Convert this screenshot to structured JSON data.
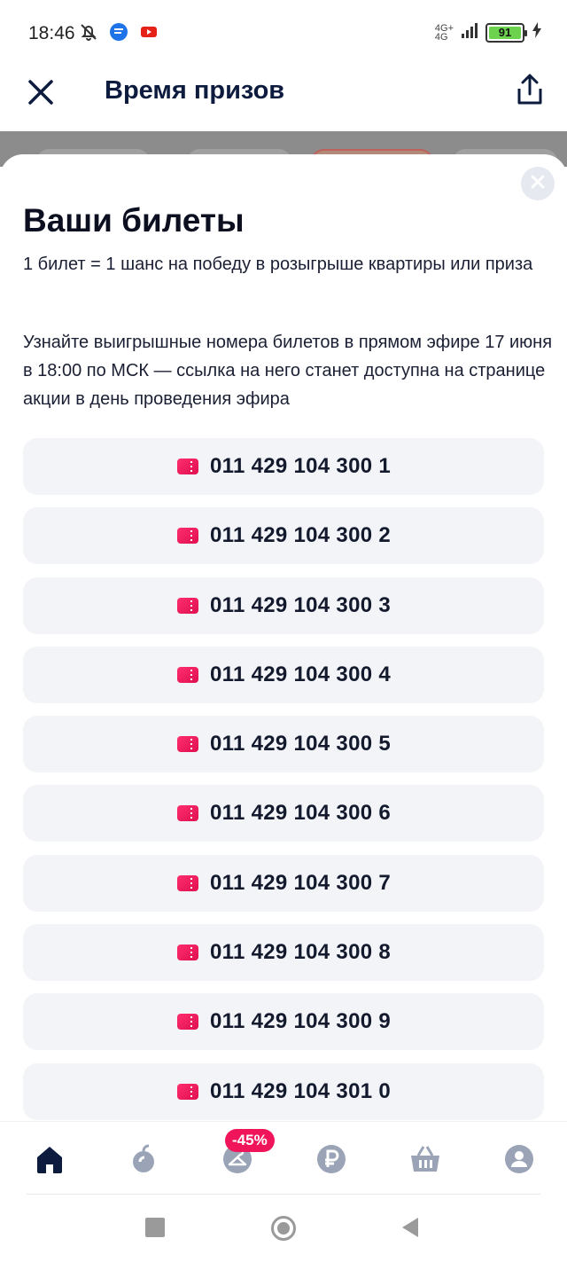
{
  "status_bar": {
    "time": "18:46",
    "network": "4G+",
    "network_sub": "4G",
    "battery": "91"
  },
  "header": {
    "title": "Время призов"
  },
  "sheet": {
    "title": "Ваши билеты",
    "paragraph1": "1 билет = 1 шанс на победу в розыгрыше квартиры или приза",
    "paragraph2": "Узнайте выигрышные номера билетов в прямом эфире 17 июня в 18:00 по МСК — ссылка на него станет доступна на странице акции в день проведения эфира",
    "tickets": [
      "011 429 104 300 1",
      "011 429 104 300 2",
      "011 429 104 300 3",
      "011 429 104 300 4",
      "011 429 104 300 5",
      "011 429 104 300 6",
      "011 429 104 300 7",
      "011 429 104 300 8",
      "011 429 104 300 9",
      "011 429 104 301 0"
    ]
  },
  "bottom_nav": {
    "discount_badge": "-45%",
    "items": [
      "home-icon",
      "catalog-icon",
      "clothes-icon",
      "ruble-icon",
      "cart-icon",
      "profile-icon"
    ]
  },
  "colors": {
    "accent": "#f0155a",
    "title": "#0d1b3e",
    "ticket_bg": "#f3f4f8"
  }
}
